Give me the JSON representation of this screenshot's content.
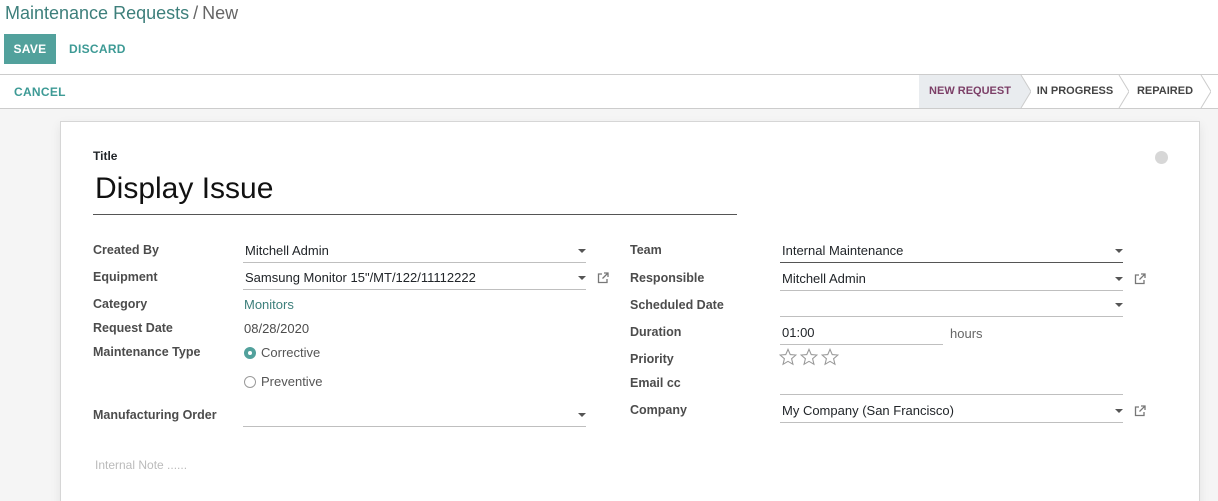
{
  "breadcrumb": {
    "parent": "Maintenance Requests",
    "separator": "/",
    "current": "New"
  },
  "toolbar": {
    "save_label": "SAVE",
    "discard_label": "DISCARD"
  },
  "statusbar": {
    "cancel_label": "CANCEL",
    "stages": [
      {
        "label": "NEW REQUEST",
        "active": true
      },
      {
        "label": "IN PROGRESS",
        "active": false
      },
      {
        "label": "REPAIRED",
        "active": false
      }
    ]
  },
  "form": {
    "title_label": "Title",
    "title_value": "Display Issue",
    "left": {
      "created_by_label": "Created By",
      "created_by_value": "Mitchell Admin",
      "equipment_label": "Equipment",
      "equipment_value": "Samsung Monitor 15\"/MT/122/11112222",
      "category_label": "Category",
      "category_value": "Monitors",
      "request_date_label": "Request Date",
      "request_date_value": "08/28/2020",
      "maintenance_type_label": "Maintenance Type",
      "maintenance_type_options": [
        {
          "label": "Corrective",
          "checked": true
        },
        {
          "label": "Preventive",
          "checked": false
        }
      ],
      "manufacturing_order_label": "Manufacturing Order",
      "manufacturing_order_value": ""
    },
    "right": {
      "team_label": "Team",
      "team_value": "Internal Maintenance",
      "responsible_label": "Responsible",
      "responsible_value": "Mitchell Admin",
      "scheduled_date_label": "Scheduled Date",
      "scheduled_date_value": "",
      "duration_label": "Duration",
      "duration_value": "01:00",
      "duration_unit": "hours",
      "priority_label": "Priority",
      "priority_stars": 0,
      "priority_max": 3,
      "email_cc_label": "Email cc",
      "email_cc_value": "",
      "company_label": "Company",
      "company_value": "My Company (San Francisco)"
    },
    "note_placeholder": "Internal Note ......"
  },
  "colors": {
    "primary": "#52a19c",
    "link": "#3d7f7b",
    "active_stage_text": "#7c3f67",
    "active_stage_bg": "#e9ecef"
  }
}
